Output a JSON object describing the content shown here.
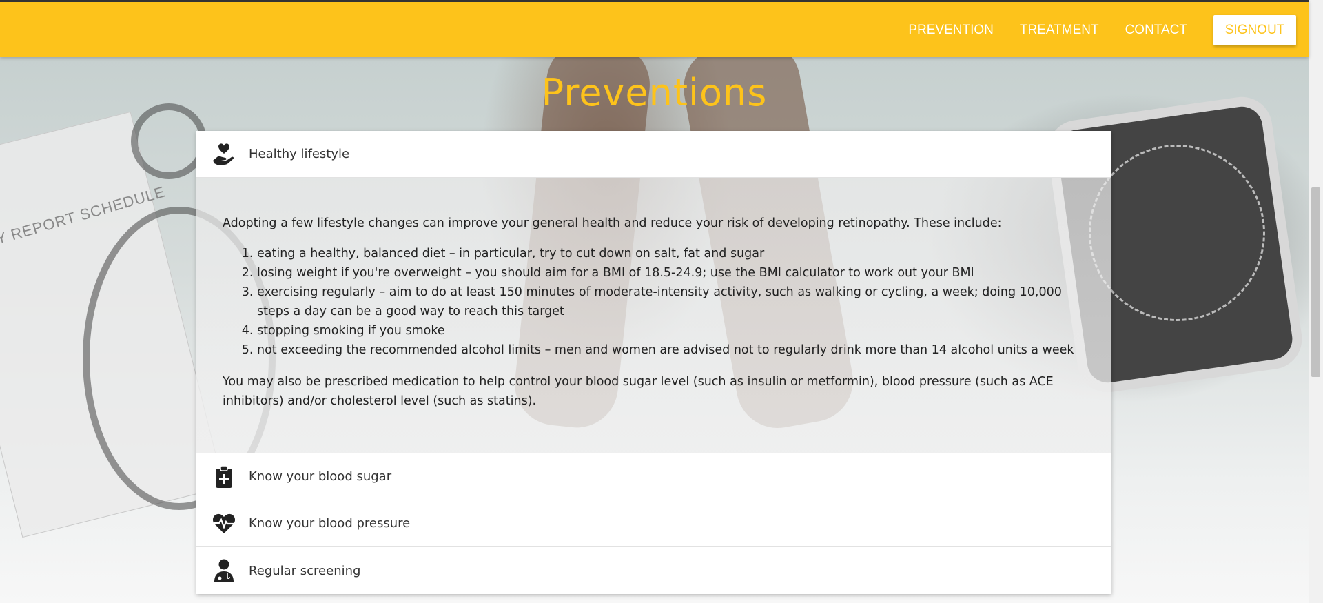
{
  "nav": {
    "links": [
      "PREVENTION",
      "TREATMENT",
      "CONTACT"
    ],
    "signout_label": "SIGNOUT"
  },
  "colors": {
    "accent": "#fdc31b",
    "nav_text": "#ffffff"
  },
  "page": {
    "title": "Preventions"
  },
  "background": {
    "clipboard_text": "Y REPORT SCHEDULE"
  },
  "accordion": {
    "sections": [
      {
        "title": "Healthy lifestyle",
        "icon": "hand-heart-icon",
        "expanded": true
      },
      {
        "title": "Know your blood sugar",
        "icon": "medical-clipboard-icon",
        "expanded": false
      },
      {
        "title": "Know your blood pressure",
        "icon": "heartbeat-icon",
        "expanded": false
      },
      {
        "title": "Regular screening",
        "icon": "doctor-icon",
        "expanded": false
      }
    ],
    "content": {
      "intro": "Adopting a few lifestyle changes can improve your general health and reduce your risk of developing retinopathy. These include:",
      "items": [
        "eating a healthy, balanced diet – in particular, try to cut down on salt, fat and sugar",
        "losing weight if you're overweight – you should aim for a BMI of 18.5-24.9; use the BMI calculator to work out your BMI",
        "exercising regularly – aim to do at least 150 minutes of moderate-intensity activity, such as walking or cycling, a week; doing 10,000 steps a day can be a good way to reach this target",
        "stopping smoking if you smoke",
        "not exceeding the recommended alcohol limits – men and women are advised not to regularly drink more than 14 alcohol units a week"
      ],
      "outro": "You may also be prescribed medication to help control your blood sugar level (such as insulin or metformin), blood pressure (such as ACE inhibitors) and/or cholesterol level (such as statins)."
    }
  }
}
